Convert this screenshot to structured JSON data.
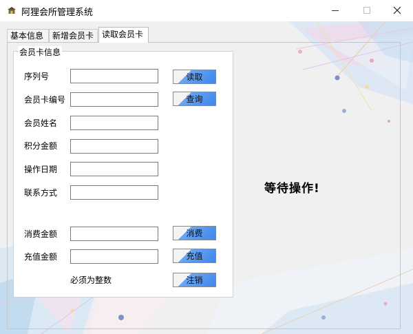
{
  "window": {
    "title": "阿狸会所管理系统",
    "icons": [
      "app-icon",
      "minimize-icon",
      "maximize-icon",
      "close-icon"
    ]
  },
  "tabs": [
    {
      "label": "基本信息",
      "active": false
    },
    {
      "label": "新增会员卡",
      "active": false
    },
    {
      "label": "读取会员卡",
      "active": true
    }
  ],
  "group": {
    "title": "会员卡信息",
    "fields": [
      {
        "label": "序列号",
        "value": ""
      },
      {
        "label": "会员卡编号",
        "value": ""
      },
      {
        "label": "会员姓名",
        "value": ""
      },
      {
        "label": "积分金额",
        "value": ""
      },
      {
        "label": "操作日期",
        "value": ""
      },
      {
        "label": "联系方式",
        "value": ""
      },
      {
        "label": "消费金额",
        "value": ""
      },
      {
        "label": "充值金额",
        "value": ""
      }
    ],
    "buttons": {
      "read": "读取",
      "query": "查询",
      "consume": "消费",
      "recharge": "充值",
      "cancel": "注销"
    },
    "hint": "必须为整数"
  },
  "status_text": "等待操作!",
  "colors": {
    "button_accent": "#3f86ea",
    "panel_background": "#f0f0f0"
  }
}
